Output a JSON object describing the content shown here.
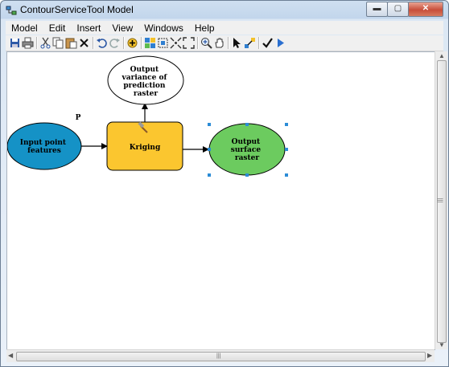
{
  "window": {
    "title": "ContourServiceTool Model",
    "minimize_glyph": "▬",
    "maximize_glyph": "▢",
    "close_glyph": "✕"
  },
  "menubar": {
    "items": [
      "Model",
      "Edit",
      "Insert",
      "View",
      "Windows",
      "Help"
    ]
  },
  "toolbar": {
    "icons": [
      "save-icon",
      "print-icon",
      "cut-icon",
      "copy-icon",
      "paste-icon",
      "delete-icon",
      "undo-icon",
      "redo-icon",
      "add-data-icon",
      "auto-layout-icon",
      "select-all-icon",
      "full-extent-icon",
      "zoom-fit-icon",
      "zoom-in-icon",
      "pan-icon",
      "select-pointer-icon",
      "connect-icon",
      "validate-icon",
      "run-icon"
    ]
  },
  "model": {
    "nodes": {
      "input": {
        "label": [
          "Input point",
          "features"
        ],
        "fill": "#1592c6",
        "shape": "ellipse"
      },
      "tool": {
        "label": [
          "Kriging"
        ],
        "fill": "#fbc62f",
        "shape": "rounded-rect"
      },
      "output_surface": {
        "label": [
          "Output",
          "surface",
          "raster"
        ],
        "fill": "#6ccb5f",
        "shape": "ellipse",
        "selected": true
      },
      "output_variance": {
        "label": [
          "Output",
          "variance of",
          "prediction",
          "raster"
        ],
        "fill": "#ffffff",
        "shape": "ellipse"
      }
    },
    "parameter_marker": "P",
    "colors": {
      "selection_handle": "#2c8cd6",
      "connector": "#000000"
    }
  },
  "scrollbars": {
    "grip_glyph": "|||",
    "up": "▲",
    "down": "▼",
    "left": "◀",
    "right": "▶"
  }
}
